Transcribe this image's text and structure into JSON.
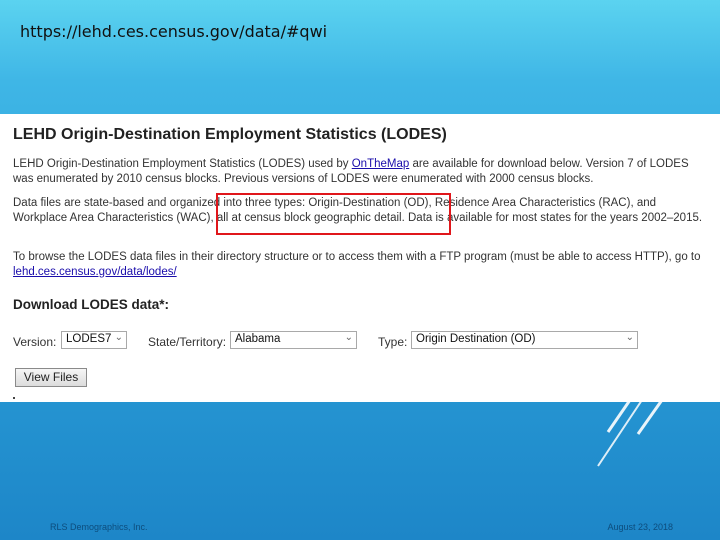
{
  "slide": {
    "url_text": "https://lehd.ces.census.gov/data/#qwi",
    "footer_left": "RLS Demographics, Inc.",
    "footer_right": "August 23, 2018"
  },
  "page": {
    "title": "LEHD Origin-Destination Employment Statistics (LODES)",
    "p1": {
      "before": "LEHD Origin-Destination Employment Statistics (LODES) used by ",
      "link": "OnTheMap",
      "after": " are available for download below. Version 7 of LODES was enumerated by 2010 census blocks. Previous versions of LODES were enumerated with 2000 census blocks."
    },
    "p2": "Data files are state-based and organized into three types: Origin-Destination (OD), Residence Area Characteristics (RAC), and Workplace Area Characteristics (WAC), all at census block geographic detail. Data is available for most states for the years 2002–2015.",
    "p3": {
      "before": "To browse the LODES data files in their directory structure or to access them with a FTP program (must be able to access HTTP), go to ",
      "link": "lehd.ces.census.gov/data/lodes/"
    },
    "download_heading": "Download LODES data*:",
    "form": {
      "version_label": "Version:",
      "version_value": "LODES7",
      "state_label": "State/Territory:",
      "state_value": "Alabama",
      "type_label": "Type:",
      "type_value": "Origin Destination (OD)",
      "view_button": "View Files"
    },
    "highlight_color": "#e0161b"
  }
}
